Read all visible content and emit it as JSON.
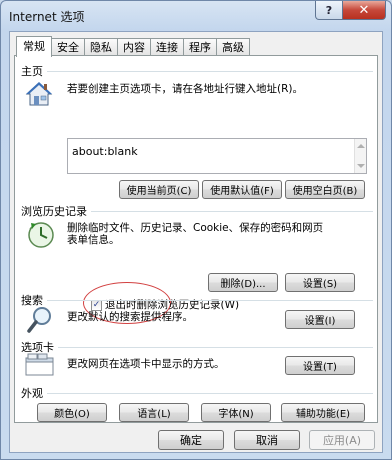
{
  "window": {
    "title": "Internet 选项",
    "help_label": "?",
    "close_label": "✕"
  },
  "tabs": [
    {
      "label": "常规",
      "active": true
    },
    {
      "label": "安全",
      "active": false
    },
    {
      "label": "隐私",
      "active": false
    },
    {
      "label": "内容",
      "active": false
    },
    {
      "label": "连接",
      "active": false
    },
    {
      "label": "程序",
      "active": false
    },
    {
      "label": "高级",
      "active": false
    }
  ],
  "homepage": {
    "heading": "主页",
    "description": "若要创建主页选项卡，请在各地址行键入地址(R)。",
    "address": "about:blank",
    "buttons": {
      "use_current": "使用当前页(C)",
      "use_default": "使用默认值(F)",
      "use_blank": "使用空白页(B)"
    }
  },
  "history": {
    "heading": "浏览历史记录",
    "description_line1": "删除临时文件、历史记录、Cookie、保存的密码和网页",
    "description_line2": "表单信息。",
    "checkbox_label": "退出时删除浏览历史记录(W)",
    "checkbox_checked": true,
    "checkbox_mark": "✓",
    "delete_button": "删除(D)...",
    "settings_button": "设置(S)"
  },
  "search": {
    "heading": "搜索",
    "description": "更改默认的搜索提供程序。",
    "settings_button": "设置(I)"
  },
  "tabs_section": {
    "heading": "选项卡",
    "description": "更改网页在选项卡中显示的方式。",
    "settings_button": "设置(T)"
  },
  "appearance": {
    "heading": "外观",
    "buttons": {
      "colors": "颜色(O)",
      "languages": "语言(L)",
      "fonts": "字体(N)",
      "accessibility": "辅助功能(E)"
    }
  },
  "footer": {
    "ok": "确定",
    "cancel": "取消",
    "apply": "应用(A)"
  },
  "colors": {
    "annotation_circle": "#d24141"
  }
}
